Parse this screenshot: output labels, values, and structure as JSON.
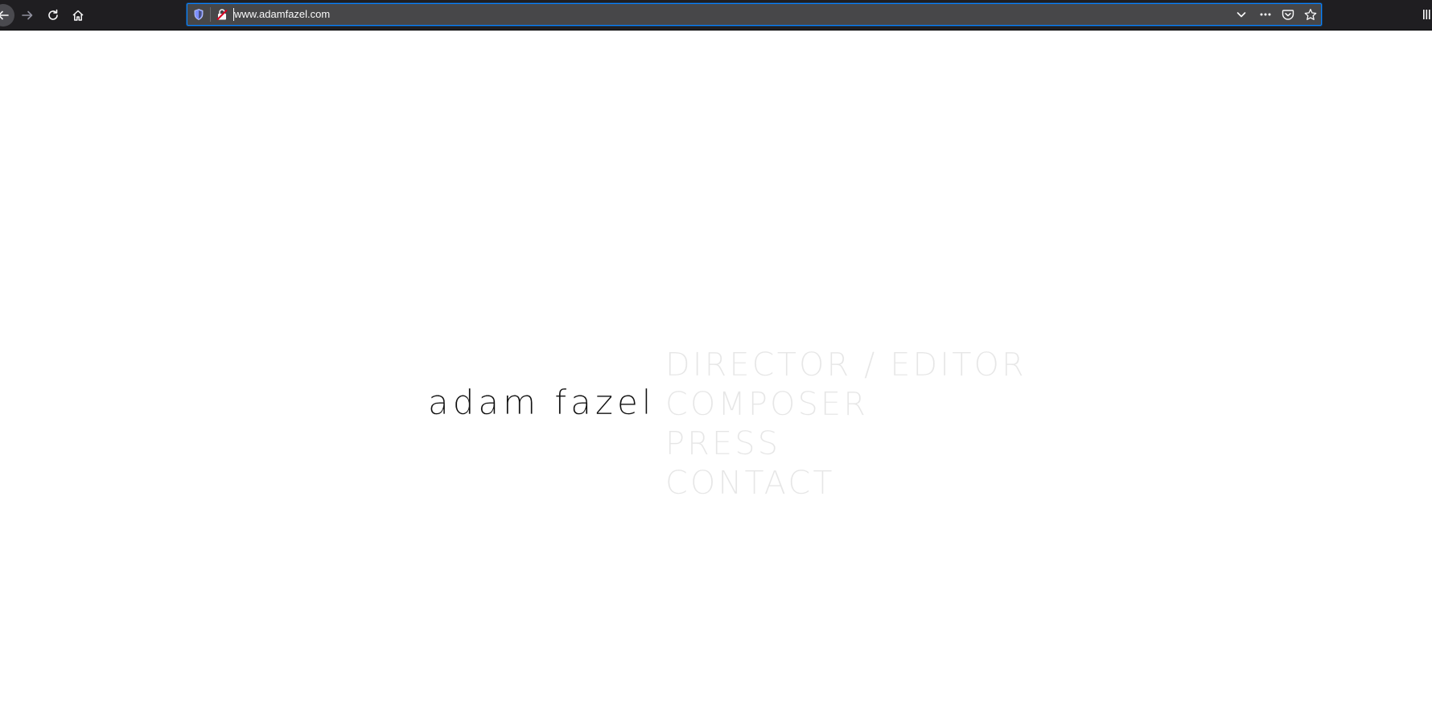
{
  "browser": {
    "url": "www.adamfazel.com",
    "icons": {
      "back": "back-arrow-icon",
      "forward": "forward-arrow-icon",
      "reload": "reload-icon",
      "home": "home-icon",
      "tracking": "shield-icon",
      "connection": "insecure-lock-icon",
      "dropdown": "chevron-down-icon",
      "more": "ellipsis-icon",
      "pocket": "pocket-icon",
      "bookmark": "star-icon",
      "library": "library-icon"
    },
    "colors": {
      "toolbar": "#1f1e21",
      "urlbar": "#474749",
      "focus_ring": "#0a84ff"
    }
  },
  "site": {
    "title": "adam fazel",
    "nav": [
      "DIRECTOR / EDITOR",
      "COMPOSER",
      "PRESS",
      "CONTACT"
    ],
    "colors": {
      "title": "#111111",
      "nav": "#e6e6e6",
      "background": "#ffffff"
    }
  }
}
